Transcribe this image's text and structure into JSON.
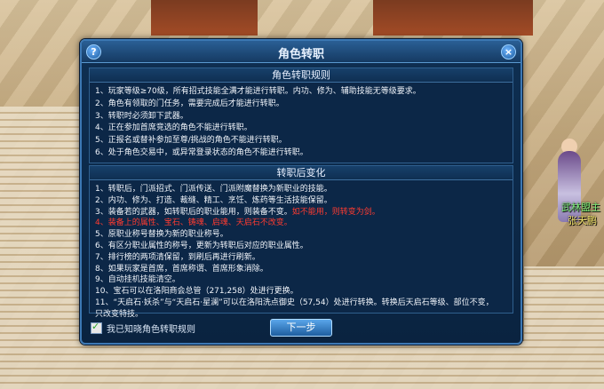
{
  "dialog": {
    "title": "角色转职",
    "help_icon": "?",
    "close_icon": "×",
    "rules_header": "角色转职规则",
    "rules": [
      "1、玩家等级≥70级，所有招式技能全满才能进行转职。内功、修为、辅助技能无等级要求。",
      "2、角色有领取的门任务，需要完成后才能进行转职。",
      "3、转职时必须卸下武器。",
      "4、正在参加首席竞选的角色不能进行转职。",
      "5、正报名或替补参加至尊/挑战的角色不能进行转职。",
      "6、处于角色交易中，或异常登录状态的角色不能进行转职。"
    ],
    "changes_header": "转职后变化",
    "changes": [
      {
        "text": "1、转职后，门派招式、门派传送、门派附魔替换为新职业的技能。",
        "red": ""
      },
      {
        "text": "2、内功、修为、打造、裁缝、精工、烹饪、炼药等生活技能保留。",
        "red": ""
      },
      {
        "text": "3、装备若的武器，如转职后的职业能用，则装备不变。",
        "red": "如不能用，则转变为剑。"
      },
      {
        "text": "",
        "red": "4、装备上的属性、宝石、铸魂、启魂、天启石不改变。"
      },
      {
        "text": "5、原职业称号替换为新的职业称号。",
        "red": ""
      },
      {
        "text": "6、有区分职业属性的称号，更新为转职后对应的职业属性。",
        "red": ""
      },
      {
        "text": "7、排行榜的两项清保留，到刷后再进行刷新。",
        "red": ""
      },
      {
        "text": "8、如果玩家是首席，首席称谓、首席形象消除。",
        "red": ""
      },
      {
        "text": "9、自动挂机技能清空。",
        "red": ""
      },
      {
        "text": "10、宝石可以在洛阳商会总管（271,258）处进行更换。",
        "red": ""
      },
      {
        "text": "11、“天启石·妖杀”与“天启石·星澜”可以在洛阳洗点御史（57,54）处进行转换。转换后天启石等级、部位不变，",
        "red": ""
      },
      {
        "text": "只改变特技。",
        "red": ""
      }
    ],
    "checkbox_label": "我已知晓角色转职规则",
    "checkbox_checked": true,
    "next_button": "下一步"
  },
  "npc": {
    "name_line1": "武林盟主",
    "name_line2": "张天鹏"
  }
}
